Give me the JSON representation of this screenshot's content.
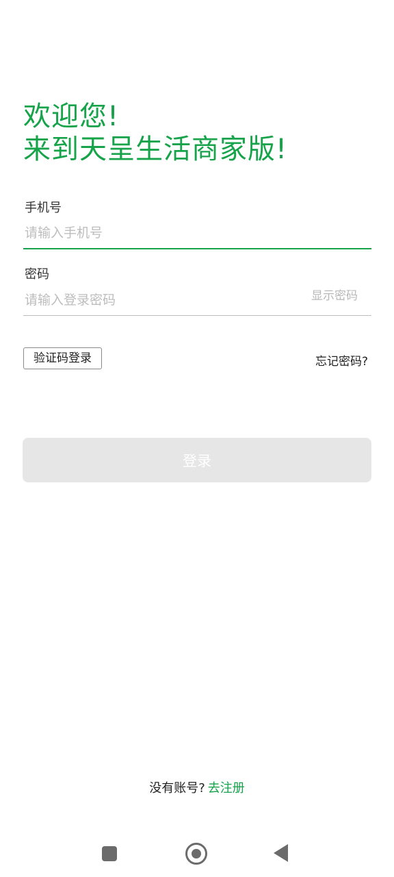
{
  "welcome": {
    "line1": "欢迎您!",
    "line2": "来到天呈生活商家版!"
  },
  "phone": {
    "label": "手机号",
    "placeholder": "请输入手机号",
    "value": ""
  },
  "password": {
    "label": "密码",
    "placeholder": "请输入登录密码",
    "value": "",
    "show_toggle": "显示密码"
  },
  "actions": {
    "sms_login": "验证码登录",
    "forgot_password": "忘记密码?",
    "login": "登录"
  },
  "register": {
    "prompt": "没有账号?",
    "link": "去注册"
  },
  "colors": {
    "accent": "#16a34a",
    "login_button_disabled": "#e6e6e6"
  },
  "navbar": {
    "icons": [
      "square-recents-icon",
      "circle-home-icon",
      "triangle-back-icon"
    ]
  }
}
